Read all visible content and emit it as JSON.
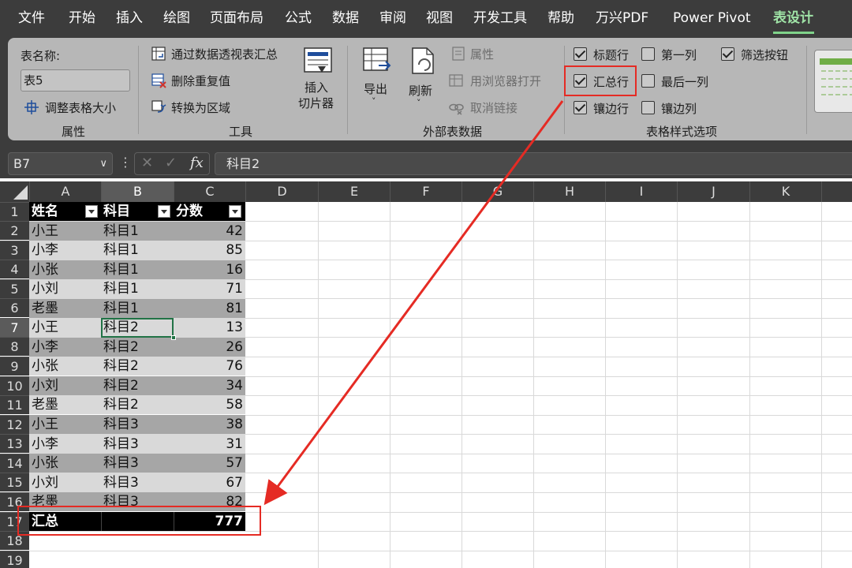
{
  "menubar": {
    "items": [
      "文件",
      "开始",
      "插入",
      "绘图",
      "页面布局",
      "公式",
      "数据",
      "审阅",
      "视图",
      "开发工具",
      "帮助",
      "万兴PDF",
      "Power Pivot",
      "表设计"
    ],
    "active": "表设计",
    "accent_color": "#9fe3a6"
  },
  "ribbon": {
    "properties": {
      "table_name_label": "表名称:",
      "table_name_value": "表5",
      "resize_label": "调整表格大小",
      "group_label": "属性"
    },
    "tools": {
      "summarize_pivot": "通过数据透视表汇总",
      "remove_duplicates": "删除重复值",
      "convert_range": "转换为区域",
      "insert_slicer": "插入",
      "insert_slicer_2": "切片器",
      "group_label": "工具"
    },
    "external": {
      "export": "导出",
      "refresh": "刷新",
      "properties": "属性",
      "open_browser": "用浏览器打开",
      "unlink": "取消链接",
      "group_label": "外部表数据"
    },
    "style_options": {
      "header_row": "标题行",
      "first_column": "第一列",
      "filter_button": "筛选按钮",
      "total_row": "汇总行",
      "last_column": "最后一列",
      "banded_rows": "镶边行",
      "banded_columns": "镶边列",
      "group_label": "表格样式选项",
      "checked": {
        "header_row": true,
        "first_column": false,
        "filter_button": true,
        "total_row": true,
        "last_column": false,
        "banded_rows": true,
        "banded_columns": false
      }
    }
  },
  "formula_bar": {
    "name_box": "B7",
    "content": "科目2",
    "fx": "fx"
  },
  "columns": [
    "A",
    "B",
    "C",
    "D",
    "E",
    "F",
    "G",
    "H",
    "I",
    "J",
    "K"
  ],
  "rows": [
    "1",
    "2",
    "3",
    "4",
    "5",
    "6",
    "7",
    "8",
    "9",
    "10",
    "11",
    "12",
    "13",
    "14",
    "15",
    "16",
    "17",
    "18",
    "19"
  ],
  "table": {
    "headers": [
      "姓名",
      "科目",
      "分数"
    ],
    "data": [
      [
        "小王",
        "科目1",
        "42"
      ],
      [
        "小李",
        "科目1",
        "85"
      ],
      [
        "小张",
        "科目1",
        "16"
      ],
      [
        "小刘",
        "科目1",
        "71"
      ],
      [
        "老墨",
        "科目1",
        "81"
      ],
      [
        "小王",
        "科目2",
        "13"
      ],
      [
        "小李",
        "科目2",
        "26"
      ],
      [
        "小张",
        "科目2",
        "76"
      ],
      [
        "小刘",
        "科目2",
        "34"
      ],
      [
        "老墨",
        "科目2",
        "58"
      ],
      [
        "小王",
        "科目3",
        "38"
      ],
      [
        "小李",
        "科目3",
        "31"
      ],
      [
        "小张",
        "科目3",
        "57"
      ],
      [
        "小刘",
        "科目3",
        "67"
      ],
      [
        "老墨",
        "科目3",
        "82"
      ]
    ],
    "total_label": "汇总",
    "total_value": "777"
  },
  "colors": {
    "annotation": "#e52b24",
    "selection": "#217346",
    "band_dark": "#a6a6a6",
    "band_light": "#d9d9d9"
  }
}
